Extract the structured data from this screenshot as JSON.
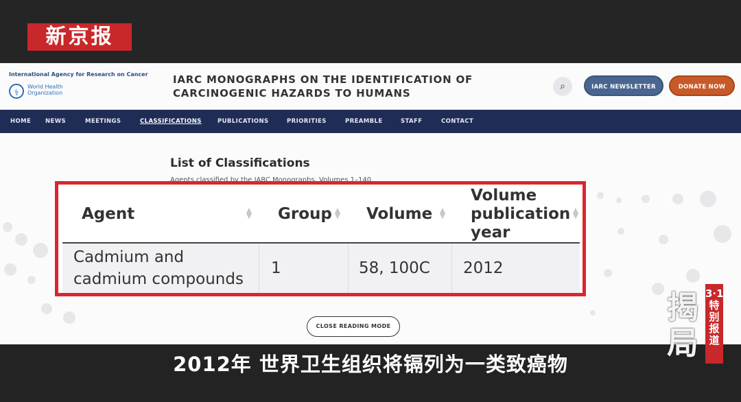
{
  "broadcast": {
    "logo": "新京报",
    "subtitle": "2012年 世界卫生组织将镉列为一类致癌物",
    "stamp_big": "揭局",
    "stamp_tag": "3·15特别报道"
  },
  "header": {
    "iarc_name": "International Agency for Research on Cancer",
    "who_name": "World Health Organization",
    "title_line1": "IARC MONOGRAPHS ON THE IDENTIFICATION OF",
    "title_line2": "CARCINOGENIC HAZARDS TO HUMANS",
    "newsletter_label": "IARC NEWSLETTER",
    "donate_label": "DONATE NOW"
  },
  "nav": {
    "items": [
      {
        "label": "HOME"
      },
      {
        "label": "NEWS"
      },
      {
        "label": "MEETINGS"
      },
      {
        "label": "CLASSIFICATIONS"
      },
      {
        "label": "PUBLICATIONS"
      },
      {
        "label": "PRIORITIES"
      },
      {
        "label": "PREAMBLE"
      },
      {
        "label": "STAFF"
      },
      {
        "label": "CONTACT"
      }
    ],
    "active": "CLASSIFICATIONS"
  },
  "main": {
    "list_title": "List of Classifications",
    "list_subtitle": "Agents classified by the IARC Monographs, Volumes 1–140",
    "close_label": "CLOSE READING MODE"
  },
  "table": {
    "columns": [
      "Agent",
      "Group",
      "Volume",
      "Volume publication year"
    ],
    "rows": [
      {
        "agent": "Cadmium and cadmium compounds",
        "group": "1",
        "volume": "58, 100C",
        "year": "2012"
      }
    ]
  },
  "colors": {
    "nav_bg": "#1f2c56",
    "highlight_border": "#d9272e",
    "newsletter_bg": "#4a6590",
    "donate_bg": "#c85a2a",
    "logo_red": "#c8282a"
  }
}
